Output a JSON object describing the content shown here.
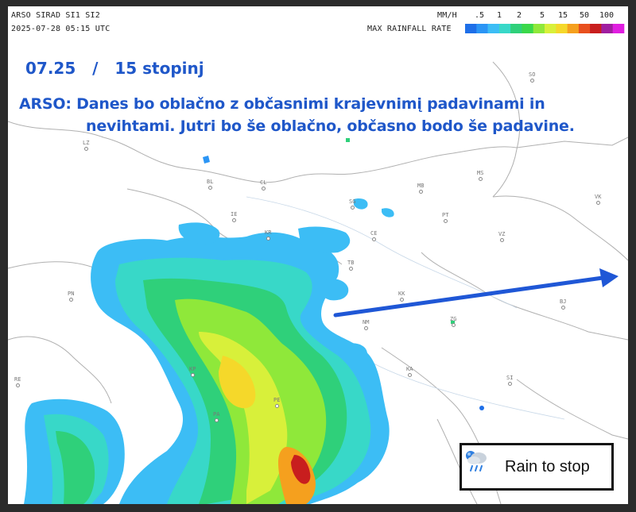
{
  "header": {
    "title": "ARSO SIRAD SI1 SI2",
    "timestamp": "2025-07-28 05:15 UTC",
    "unit": "MM/H",
    "scale_caption": "MAX RAINFALL RATE"
  },
  "legend": {
    "labels": [
      ".5",
      "1",
      "2",
      "5",
      "15",
      "50",
      "100"
    ],
    "colors": [
      "#1e6fe8",
      "#2b95f5",
      "#3cbdf5",
      "#38d8c8",
      "#2fd07a",
      "#3ad84a",
      "#8fe83a",
      "#d8f03a",
      "#f5d82a",
      "#f5a01e",
      "#e8501e",
      "#c81e1e",
      "#a01ea0",
      "#e01ee0"
    ]
  },
  "overlay": {
    "date_line": "07.25   /   15 stopinj",
    "forecast_line1": "ARSO:  Danes bo oblačno z občasnimi krajevnimį padavinami in",
    "forecast_line2": "nevihtami. Jutri bo še oblačno, občasno bodo še padavine."
  },
  "cities": [
    "SO",
    "LZ",
    "MS",
    "BL",
    "CL",
    "MB",
    "VK",
    "SG",
    "PT",
    "VZ",
    "IE",
    "KR",
    "CE",
    "TB",
    "PN",
    "BJ",
    "KK",
    "NM",
    "ZG",
    "KA",
    "SI",
    "KP",
    "PE",
    "PA",
    "RE"
  ],
  "button": {
    "label": "Rain to stop",
    "icon": "rain-cloud-icon"
  }
}
